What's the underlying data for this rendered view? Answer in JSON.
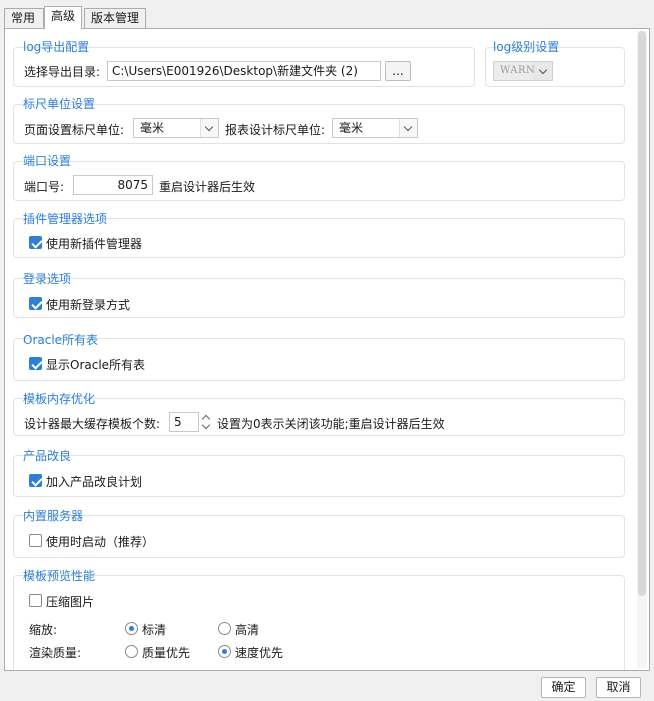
{
  "tabs": [
    {
      "label": "常用",
      "active": false
    },
    {
      "label": "高级",
      "active": true
    },
    {
      "label": "版本管理",
      "active": false
    }
  ],
  "log_export": {
    "title": "log导出配置",
    "dir_label": "选择导出目录:",
    "dir_value": "C:\\Users\\E001926\\Desktop\\新建文件夹 (2)",
    "browse_label": "..."
  },
  "log_level": {
    "title": "log级别设置",
    "value": "WARN"
  },
  "ruler": {
    "title": "标尺单位设置",
    "page_label": "页面设置标尺单位:",
    "page_value": "毫米",
    "report_label": "报表设计标尺单位:",
    "report_value": "毫米"
  },
  "port": {
    "title": "端口设置",
    "label": "端口号:",
    "value": "8075",
    "note": "重启设计器后生效"
  },
  "plugin": {
    "title": "插件管理器选项",
    "checkbox_label": "使用新插件管理器",
    "checked": true
  },
  "login": {
    "title": "登录选项",
    "checkbox_label": "使用新登录方式",
    "checked": true
  },
  "oracle": {
    "title": "Oracle所有表",
    "checkbox_label": "显示Oracle所有表",
    "checked": true
  },
  "memory": {
    "title": "模板内存优化",
    "label": "设计器最大缓存模板个数:",
    "value": "5",
    "note": "设置为0表示关闭该功能;重启设计器后生效"
  },
  "improve": {
    "title": "产品改良",
    "checkbox_label": "加入产品改良计划",
    "checked": true
  },
  "server": {
    "title": "内置服务器",
    "checkbox_label": "使用时启动（推荐）",
    "checked": false
  },
  "preview": {
    "title": "模板预览性能",
    "compress_label": "压缩图片",
    "compress_checked": false,
    "zoom_label": "缩放:",
    "zoom_options": [
      "标清",
      "高清"
    ],
    "zoom_selected": "标清",
    "render_label": "渲染质量:",
    "render_options": [
      "质量优先",
      "速度优先"
    ],
    "render_selected": "速度优先"
  },
  "footer": {
    "ok_label": "确定",
    "cancel_label": "取消"
  },
  "colors": {
    "group_title": "#2d7fd6",
    "accent": "#2f7fd4"
  }
}
